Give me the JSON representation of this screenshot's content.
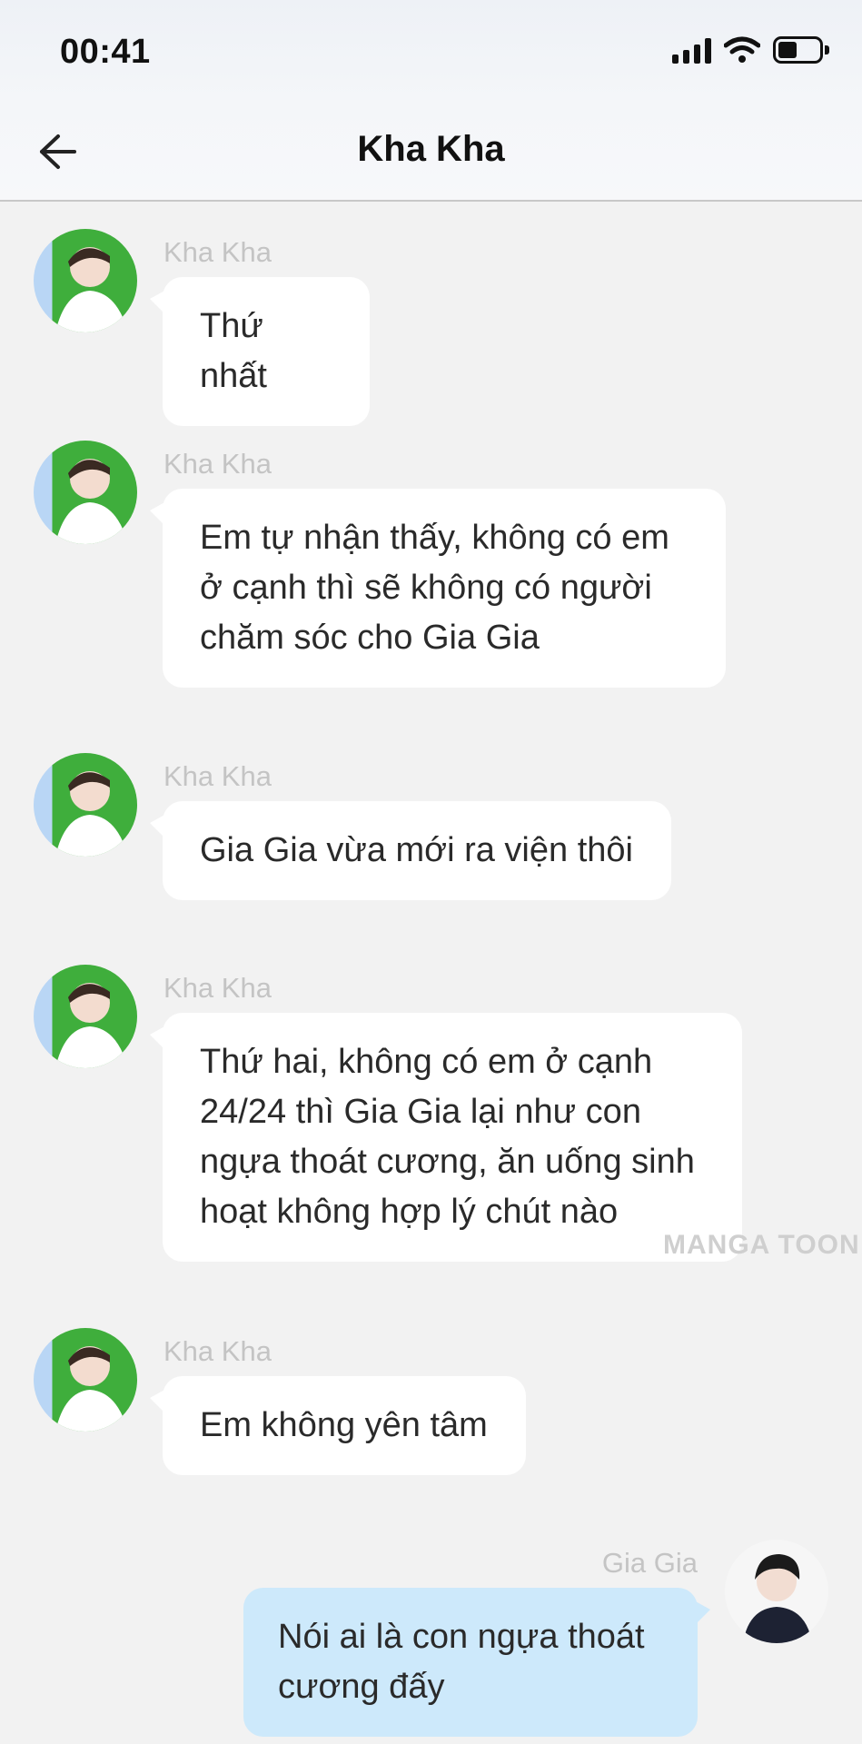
{
  "status_bar": {
    "time": "00:41",
    "icons": [
      "signal-icon",
      "wifi-icon",
      "battery-icon"
    ]
  },
  "header": {
    "back_icon": "arrow-left-icon",
    "title": "Kha Kha"
  },
  "messages": [
    {
      "sender": "Kha Kha",
      "side": "left",
      "lines": [
        "Thứ nhất"
      ]
    },
    {
      "sender": "Kha Kha",
      "side": "left",
      "lines": [
        "Em tự nhận thấy, không có em",
        "ở cạnh thì sẽ không có người",
        "chăm sóc cho Gia Gia"
      ]
    },
    {
      "sender": "Kha Kha",
      "side": "left",
      "lines": [
        "Gia Gia vừa mới ra viện thôi"
      ]
    },
    {
      "sender": "Kha Kha",
      "side": "left",
      "lines": [
        "Thứ hai, không có em ở cạnh",
        "24/24 thì Gia Gia lại như con",
        "ngựa thoát cương, ăn uống sinh",
        "hoạt không hợp lý chút nào"
      ]
    },
    {
      "sender": "Kha Kha",
      "side": "left",
      "lines": [
        "Em không yên tâm"
      ]
    },
    {
      "sender": "Gia Gia",
      "side": "right",
      "lines": [
        "Nói ai là con ngựa thoát",
        "cương đấy"
      ]
    }
  ],
  "watermark": "MANGA TOON",
  "colors": {
    "background": "#f2f2f2",
    "bubble_left": "#ffffff",
    "bubble_right": "#cde9fb",
    "sender_name": "#c4c4c4"
  }
}
